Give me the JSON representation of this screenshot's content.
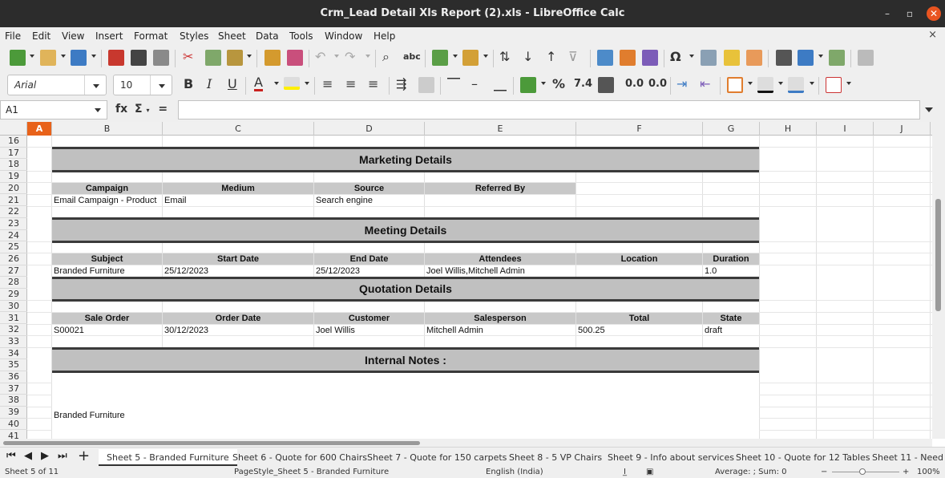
{
  "window": {
    "title": "Crm_Lead Detail Xls Report (2).xls - LibreOffice Calc",
    "minimize": "–",
    "restore": "▫",
    "close": "✕"
  },
  "menu": [
    "File",
    "Edit",
    "View",
    "Insert",
    "Format",
    "Styles",
    "Sheet",
    "Data",
    "Tools",
    "Window",
    "Help"
  ],
  "menu_close": "×",
  "format_toolbar": {
    "font_name": "Arial",
    "font_size": "10"
  },
  "formula_bar": {
    "cell_ref": "A1",
    "fx": "fx",
    "sigma": "Σ",
    "equals": "=",
    "content": ""
  },
  "columns": [
    "A",
    "B",
    "C",
    "D",
    "E",
    "F",
    "G",
    "H",
    "I",
    "J"
  ],
  "rows": [
    "16",
    "17",
    "18",
    "19",
    "20",
    "21",
    "22",
    "23",
    "24",
    "25",
    "26",
    "27",
    "28",
    "29",
    "30",
    "31",
    "32",
    "33",
    "34",
    "35",
    "36",
    "37",
    "38",
    "39",
    "40",
    "41"
  ],
  "marketing": {
    "title": "Marketing Details",
    "headers": [
      "Campaign",
      "Medium",
      "Source",
      "Referred By"
    ],
    "values": [
      "Email Campaign - Product",
      "Email",
      "Search engine",
      ""
    ]
  },
  "meeting": {
    "title": "Meeting Details",
    "headers": [
      "Subject",
      "Start Date",
      "End Date",
      "Attendees",
      "Location",
      "Duration"
    ],
    "values": [
      "Branded Furniture",
      "25/12/2023",
      "25/12/2023",
      "Joel Willis,Mitchell Admin",
      "",
      "1.0"
    ]
  },
  "quotation": {
    "title": "Quotation Details",
    "headers": [
      "Sale Order",
      "Order Date",
      "Customer",
      "Salesperson",
      "Total",
      "State"
    ],
    "values": [
      "S00021",
      "30/12/2023",
      "Joel Willis",
      "Mitchell Admin",
      "500.25",
      "draft"
    ]
  },
  "notes": {
    "title": "Internal Notes :",
    "text": "Branded Furniture"
  },
  "sheet_tabs": [
    {
      "label": "Sheet 5 - Branded Furniture",
      "active": true
    },
    {
      "label": "Sheet 6 - Quote for 600 Chairs",
      "active": false
    },
    {
      "label": "Sheet 7 - Quote for 150 carpets",
      "active": false
    },
    {
      "label": "Sheet 8 - 5 VP Chairs",
      "active": false
    },
    {
      "label": "Sheet 9 - Info about services",
      "active": false
    },
    {
      "label": "Sheet 10 - Quote for 12 Tables",
      "active": false
    },
    {
      "label": "Sheet 11 - Need",
      "active": false
    }
  ],
  "status": {
    "sheet": "Sheet 5 of 11",
    "page_style": "PageStyle_Sheet 5 - Branded Furniture",
    "language": "English (India)",
    "summary": "Average: ; Sum: 0",
    "zoom": "100%"
  },
  "colors": {
    "active_header": "#e8621a",
    "section_fill": "#c0c0c0",
    "close_button": "#e95420"
  }
}
